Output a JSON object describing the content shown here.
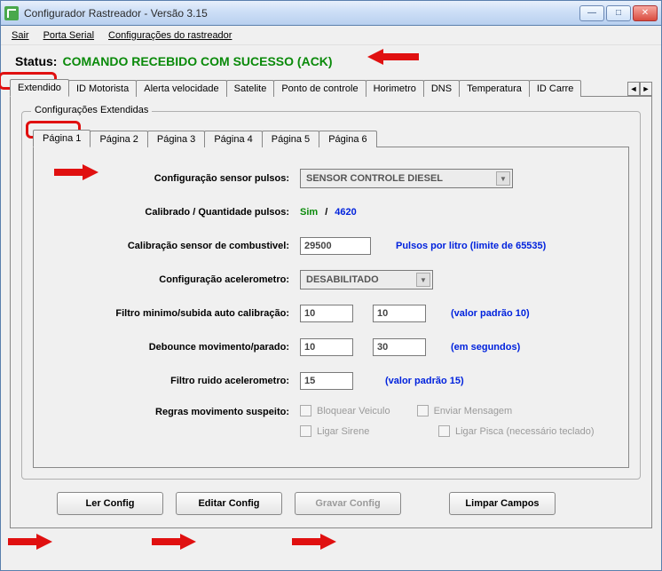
{
  "window": {
    "title": "Configurador Rastreador - Versão 3.15"
  },
  "menu": {
    "items": [
      "Sair",
      "Porta Serial",
      "Configurações do rastreador"
    ]
  },
  "status": {
    "label": "Status:",
    "value": "COMANDO RECEBIDO COM SUCESSO (ACK)"
  },
  "tabs": {
    "items": [
      "Extendido",
      "ID Motorista",
      "Alerta velocidade",
      "Satelite",
      "Ponto de controle",
      "Horimetro",
      "DNS",
      "Temperatura",
      "ID Carre"
    ],
    "active": 0
  },
  "groupbox": {
    "legend": "Configurações Extendidas"
  },
  "subtabs": {
    "items": [
      "Página 1",
      "Página 2",
      "Página 3",
      "Página 4",
      "Página 5",
      "Página 6"
    ],
    "active": 0
  },
  "form": {
    "sensor_pulsos": {
      "label": "Configuração sensor pulsos:",
      "value": "SENSOR CONTROLE DIESEL"
    },
    "calibrado": {
      "label": "Calibrado / Quantidade pulsos:",
      "sim": "Sim",
      "sep": "/",
      "qty": "4620"
    },
    "calib_combustivel": {
      "label": "Calibração sensor de combustivel:",
      "value": "29500",
      "hint": "Pulsos por litro (limite de 65535)"
    },
    "acelerometro": {
      "label": "Configuração acelerometro:",
      "value": "DESABILITADO"
    },
    "filtro_calib": {
      "label": "Filtro minimo/subida auto calibração:",
      "v1": "10",
      "v2": "10",
      "hint": "(valor padrão 10)"
    },
    "debounce": {
      "label": "Debounce movimento/parado:",
      "v1": "10",
      "v2": "30",
      "hint": "(em segundos)"
    },
    "filtro_ruido": {
      "label": "Filtro ruido acelerometro:",
      "value": "15",
      "hint": "(valor padrão 15)"
    },
    "regras": {
      "label": "Regras movimento suspeito:",
      "opts": [
        "Bloquear Veiculo",
        "Enviar Mensagem",
        "Ligar Sirene",
        "Ligar Pisca (necessário teclado)"
      ]
    }
  },
  "buttons": {
    "ler": "Ler Config",
    "editar": "Editar Config",
    "gravar": "Gravar Config",
    "limpar": "Limpar Campos"
  }
}
